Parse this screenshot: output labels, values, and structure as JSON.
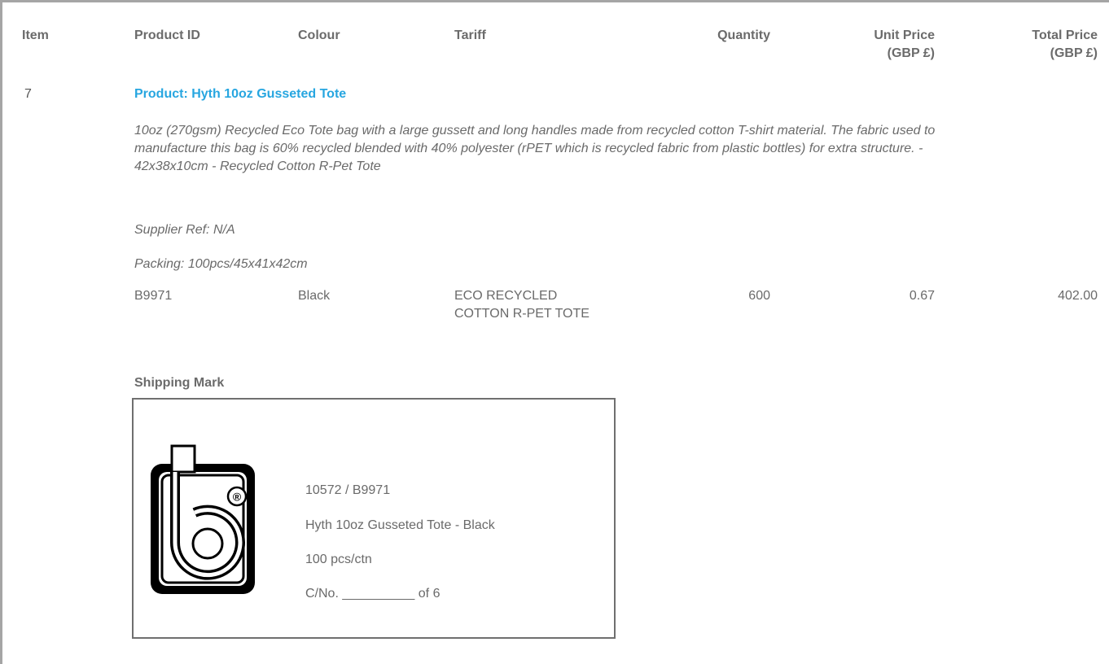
{
  "headers": {
    "item": "Item",
    "product_id": "Product ID",
    "colour": "Colour",
    "tariff": "Tariff",
    "quantity": "Quantity",
    "unit_price_1": "Unit Price",
    "unit_price_2": "(GBP £)",
    "total_price_1": "Total Price",
    "total_price_2": "(GBP £)"
  },
  "item": {
    "number": "7",
    "title": "Product: Hyth 10oz Gusseted Tote",
    "description": "10oz (270gsm) Recycled Eco Tote bag with a large gussett and long handles made from recycled cotton T-shirt material. The fabric used to manufacture this bag is 60% recycled blended with 40% polyester (rPET which is recycled fabric from plastic bottles) for extra structure. - 42x38x10cm - Recycled Cotton R-Pet Tote",
    "supplier_ref": "Supplier Ref: N/A",
    "packing": "Packing: 100pcs/45x41x42cm"
  },
  "row": {
    "product_id": "B9971",
    "colour": "Black",
    "tariff": "ECO RECYCLED COTTON R-PET TOTE",
    "quantity": "600",
    "unit_price": "0.67",
    "total_price": "402.00"
  },
  "shipping": {
    "title": "Shipping Mark",
    "line1": "10572 / B9971",
    "line2": "Hyth 10oz Gusseted Tote - Black",
    "line3": "100 pcs/ctn",
    "line4": "C/No. __________ of 6",
    "logo_text": "®"
  }
}
